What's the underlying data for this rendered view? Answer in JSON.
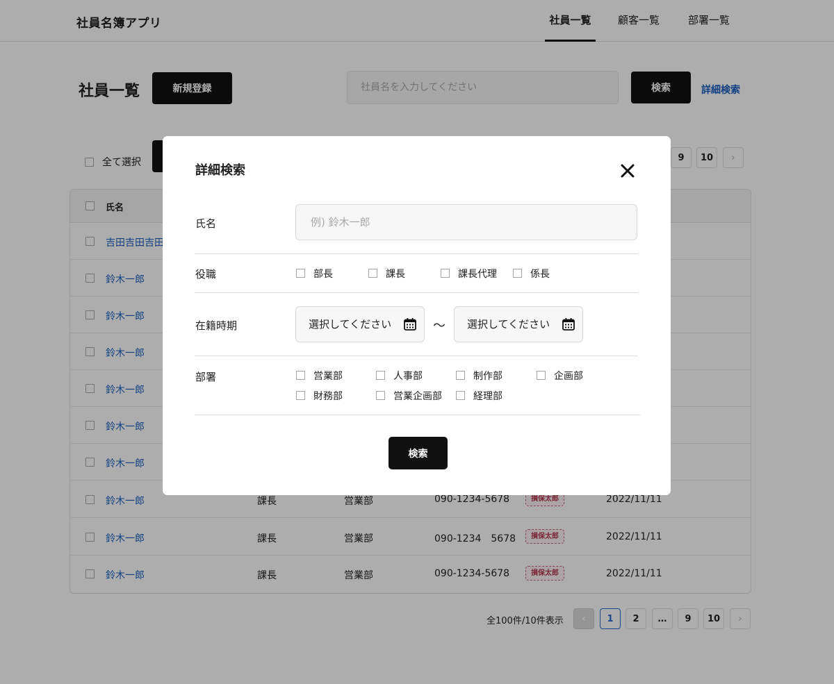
{
  "header": {
    "app_title": "社員名簿アプリ",
    "nav": [
      "社員一覧",
      "顧客一覧",
      "部署一覧"
    ]
  },
  "main": {
    "title": "社員一覧",
    "new_button": "新規登録",
    "search_placeholder": "社員名を入力してください",
    "search_button": "検索",
    "advanced_link": "詳細検索",
    "select_all": "全て選択",
    "table": {
      "header_name": "氏名",
      "rows": [
        {
          "name": "吉田吉田吉田",
          "position": "",
          "dept": "",
          "tel": "",
          "stamp": "",
          "date": ""
        },
        {
          "name": "鈴木一郎",
          "position": "",
          "dept": "",
          "tel": "",
          "stamp": "",
          "date": ""
        },
        {
          "name": "鈴木一郎",
          "position": "",
          "dept": "",
          "tel": "",
          "stamp": "",
          "date": ""
        },
        {
          "name": "鈴木一郎",
          "position": "",
          "dept": "",
          "tel": "",
          "stamp": "",
          "date": ""
        },
        {
          "name": "鈴木一郎",
          "position": "",
          "dept": "",
          "tel": "",
          "stamp": "",
          "date": ""
        },
        {
          "name": "鈴木一郎",
          "position": "",
          "dept": "",
          "tel": "",
          "stamp": "",
          "date": ""
        },
        {
          "name": "鈴木一郎",
          "position": "",
          "dept": "",
          "tel": "",
          "stamp": "",
          "date": ""
        },
        {
          "name": "鈴木一郎",
          "position": "課長",
          "dept": "営業部",
          "tel": "090-1234-5678",
          "stamp": "損保太郎",
          "date": "2022/11/11"
        },
        {
          "name": "鈴木一郎",
          "position": "課長",
          "dept": "営業部",
          "tel": "090-1234　5678",
          "stamp": "損保太郎",
          "date": "2022/11/11"
        },
        {
          "name": "鈴木一郎",
          "position": "課長",
          "dept": "営業部",
          "tel": "090-1234-5678",
          "stamp": "損保太郎",
          "date": "2022/11/11"
        }
      ]
    },
    "pagination": {
      "count_text": "全100件/10件表示",
      "pages": [
        "1",
        "2",
        "…",
        "9",
        "10"
      ],
      "current_page": "1",
      "top_partial_pages": [
        "9",
        "10"
      ]
    }
  },
  "modal": {
    "title": "詳細検索",
    "name_label": "氏名",
    "name_placeholder": "例) 鈴木一郎",
    "position_label": "役職",
    "positions": [
      "部長",
      "課長",
      "課長代理",
      "係長"
    ],
    "period_label": "在籍時期",
    "date_placeholder_start": "選択してください",
    "date_placeholder_end": "選択してください",
    "tilde": "〜",
    "dept_label": "部署",
    "departments": [
      "営業部",
      "人事部",
      "制作部",
      "企画部",
      "財務部",
      "営業企画部",
      "経理部"
    ],
    "search_button": "検索"
  },
  "colors": {
    "accent_blue": "#1b5fc1",
    "black": "#111111",
    "stamp_red": "#b33a52"
  }
}
